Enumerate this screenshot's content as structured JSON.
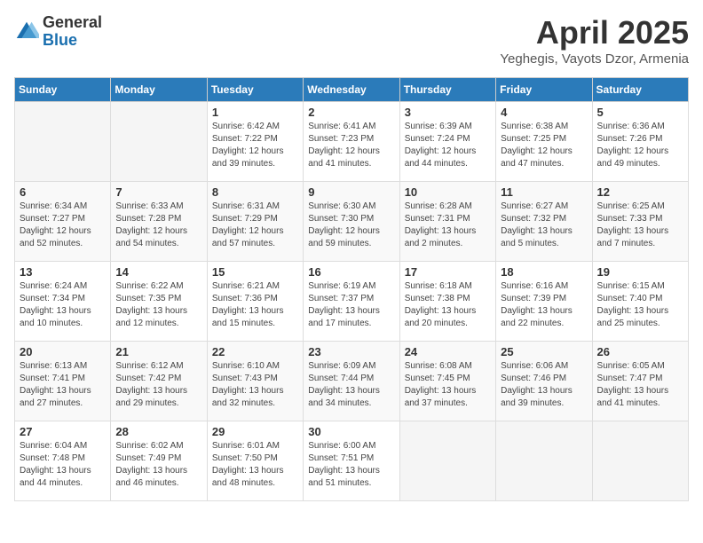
{
  "header": {
    "logo_general": "General",
    "logo_blue": "Blue",
    "month": "April 2025",
    "location": "Yeghegis, Vayots Dzor, Armenia"
  },
  "columns": [
    "Sunday",
    "Monday",
    "Tuesday",
    "Wednesday",
    "Thursday",
    "Friday",
    "Saturday"
  ],
  "weeks": [
    [
      {
        "day": "",
        "info": ""
      },
      {
        "day": "",
        "info": ""
      },
      {
        "day": "1",
        "info": "Sunrise: 6:42 AM\nSunset: 7:22 PM\nDaylight: 12 hours\nand 39 minutes."
      },
      {
        "day": "2",
        "info": "Sunrise: 6:41 AM\nSunset: 7:23 PM\nDaylight: 12 hours\nand 41 minutes."
      },
      {
        "day": "3",
        "info": "Sunrise: 6:39 AM\nSunset: 7:24 PM\nDaylight: 12 hours\nand 44 minutes."
      },
      {
        "day": "4",
        "info": "Sunrise: 6:38 AM\nSunset: 7:25 PM\nDaylight: 12 hours\nand 47 minutes."
      },
      {
        "day": "5",
        "info": "Sunrise: 6:36 AM\nSunset: 7:26 PM\nDaylight: 12 hours\nand 49 minutes."
      }
    ],
    [
      {
        "day": "6",
        "info": "Sunrise: 6:34 AM\nSunset: 7:27 PM\nDaylight: 12 hours\nand 52 minutes."
      },
      {
        "day": "7",
        "info": "Sunrise: 6:33 AM\nSunset: 7:28 PM\nDaylight: 12 hours\nand 54 minutes."
      },
      {
        "day": "8",
        "info": "Sunrise: 6:31 AM\nSunset: 7:29 PM\nDaylight: 12 hours\nand 57 minutes."
      },
      {
        "day": "9",
        "info": "Sunrise: 6:30 AM\nSunset: 7:30 PM\nDaylight: 12 hours\nand 59 minutes."
      },
      {
        "day": "10",
        "info": "Sunrise: 6:28 AM\nSunset: 7:31 PM\nDaylight: 13 hours\nand 2 minutes."
      },
      {
        "day": "11",
        "info": "Sunrise: 6:27 AM\nSunset: 7:32 PM\nDaylight: 13 hours\nand 5 minutes."
      },
      {
        "day": "12",
        "info": "Sunrise: 6:25 AM\nSunset: 7:33 PM\nDaylight: 13 hours\nand 7 minutes."
      }
    ],
    [
      {
        "day": "13",
        "info": "Sunrise: 6:24 AM\nSunset: 7:34 PM\nDaylight: 13 hours\nand 10 minutes."
      },
      {
        "day": "14",
        "info": "Sunrise: 6:22 AM\nSunset: 7:35 PM\nDaylight: 13 hours\nand 12 minutes."
      },
      {
        "day": "15",
        "info": "Sunrise: 6:21 AM\nSunset: 7:36 PM\nDaylight: 13 hours\nand 15 minutes."
      },
      {
        "day": "16",
        "info": "Sunrise: 6:19 AM\nSunset: 7:37 PM\nDaylight: 13 hours\nand 17 minutes."
      },
      {
        "day": "17",
        "info": "Sunrise: 6:18 AM\nSunset: 7:38 PM\nDaylight: 13 hours\nand 20 minutes."
      },
      {
        "day": "18",
        "info": "Sunrise: 6:16 AM\nSunset: 7:39 PM\nDaylight: 13 hours\nand 22 minutes."
      },
      {
        "day": "19",
        "info": "Sunrise: 6:15 AM\nSunset: 7:40 PM\nDaylight: 13 hours\nand 25 minutes."
      }
    ],
    [
      {
        "day": "20",
        "info": "Sunrise: 6:13 AM\nSunset: 7:41 PM\nDaylight: 13 hours\nand 27 minutes."
      },
      {
        "day": "21",
        "info": "Sunrise: 6:12 AM\nSunset: 7:42 PM\nDaylight: 13 hours\nand 29 minutes."
      },
      {
        "day": "22",
        "info": "Sunrise: 6:10 AM\nSunset: 7:43 PM\nDaylight: 13 hours\nand 32 minutes."
      },
      {
        "day": "23",
        "info": "Sunrise: 6:09 AM\nSunset: 7:44 PM\nDaylight: 13 hours\nand 34 minutes."
      },
      {
        "day": "24",
        "info": "Sunrise: 6:08 AM\nSunset: 7:45 PM\nDaylight: 13 hours\nand 37 minutes."
      },
      {
        "day": "25",
        "info": "Sunrise: 6:06 AM\nSunset: 7:46 PM\nDaylight: 13 hours\nand 39 minutes."
      },
      {
        "day": "26",
        "info": "Sunrise: 6:05 AM\nSunset: 7:47 PM\nDaylight: 13 hours\nand 41 minutes."
      }
    ],
    [
      {
        "day": "27",
        "info": "Sunrise: 6:04 AM\nSunset: 7:48 PM\nDaylight: 13 hours\nand 44 minutes."
      },
      {
        "day": "28",
        "info": "Sunrise: 6:02 AM\nSunset: 7:49 PM\nDaylight: 13 hours\nand 46 minutes."
      },
      {
        "day": "29",
        "info": "Sunrise: 6:01 AM\nSunset: 7:50 PM\nDaylight: 13 hours\nand 48 minutes."
      },
      {
        "day": "30",
        "info": "Sunrise: 6:00 AM\nSunset: 7:51 PM\nDaylight: 13 hours\nand 51 minutes."
      },
      {
        "day": "",
        "info": ""
      },
      {
        "day": "",
        "info": ""
      },
      {
        "day": "",
        "info": ""
      }
    ]
  ]
}
